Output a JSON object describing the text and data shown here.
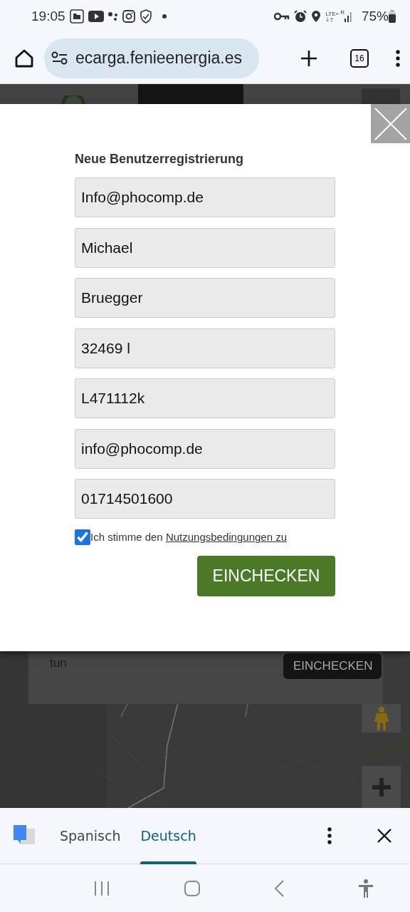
{
  "status_bar": {
    "time": "19:05",
    "network": "LTE+",
    "roaming": "R",
    "battery": "75%"
  },
  "browser": {
    "url": "ecarga.fenieenergia.es",
    "tab_count": "16"
  },
  "modal": {
    "title": "Neue Benutzerregistrierung",
    "fields": [
      {
        "value": "Info@phocomp.de"
      },
      {
        "value": "Michael"
      },
      {
        "value": "Bruegger"
      },
      {
        "value": "32469 l"
      },
      {
        "value": "L471112k"
      },
      {
        "value": "info@phocomp.de"
      },
      {
        "value": "01714501600"
      }
    ],
    "terms": {
      "checked": true,
      "text": "Ich stimme den ",
      "link": "Nutzungsbedingungen zu"
    },
    "submit": "EINCHECKEN"
  },
  "background_page": {
    "panel_text": "tun",
    "panel_button": "EINCHECKEN"
  },
  "translate_bar": {
    "languages": [
      {
        "label": "Spanisch",
        "selected": false
      },
      {
        "label": "Deutsch",
        "selected": true
      }
    ]
  }
}
